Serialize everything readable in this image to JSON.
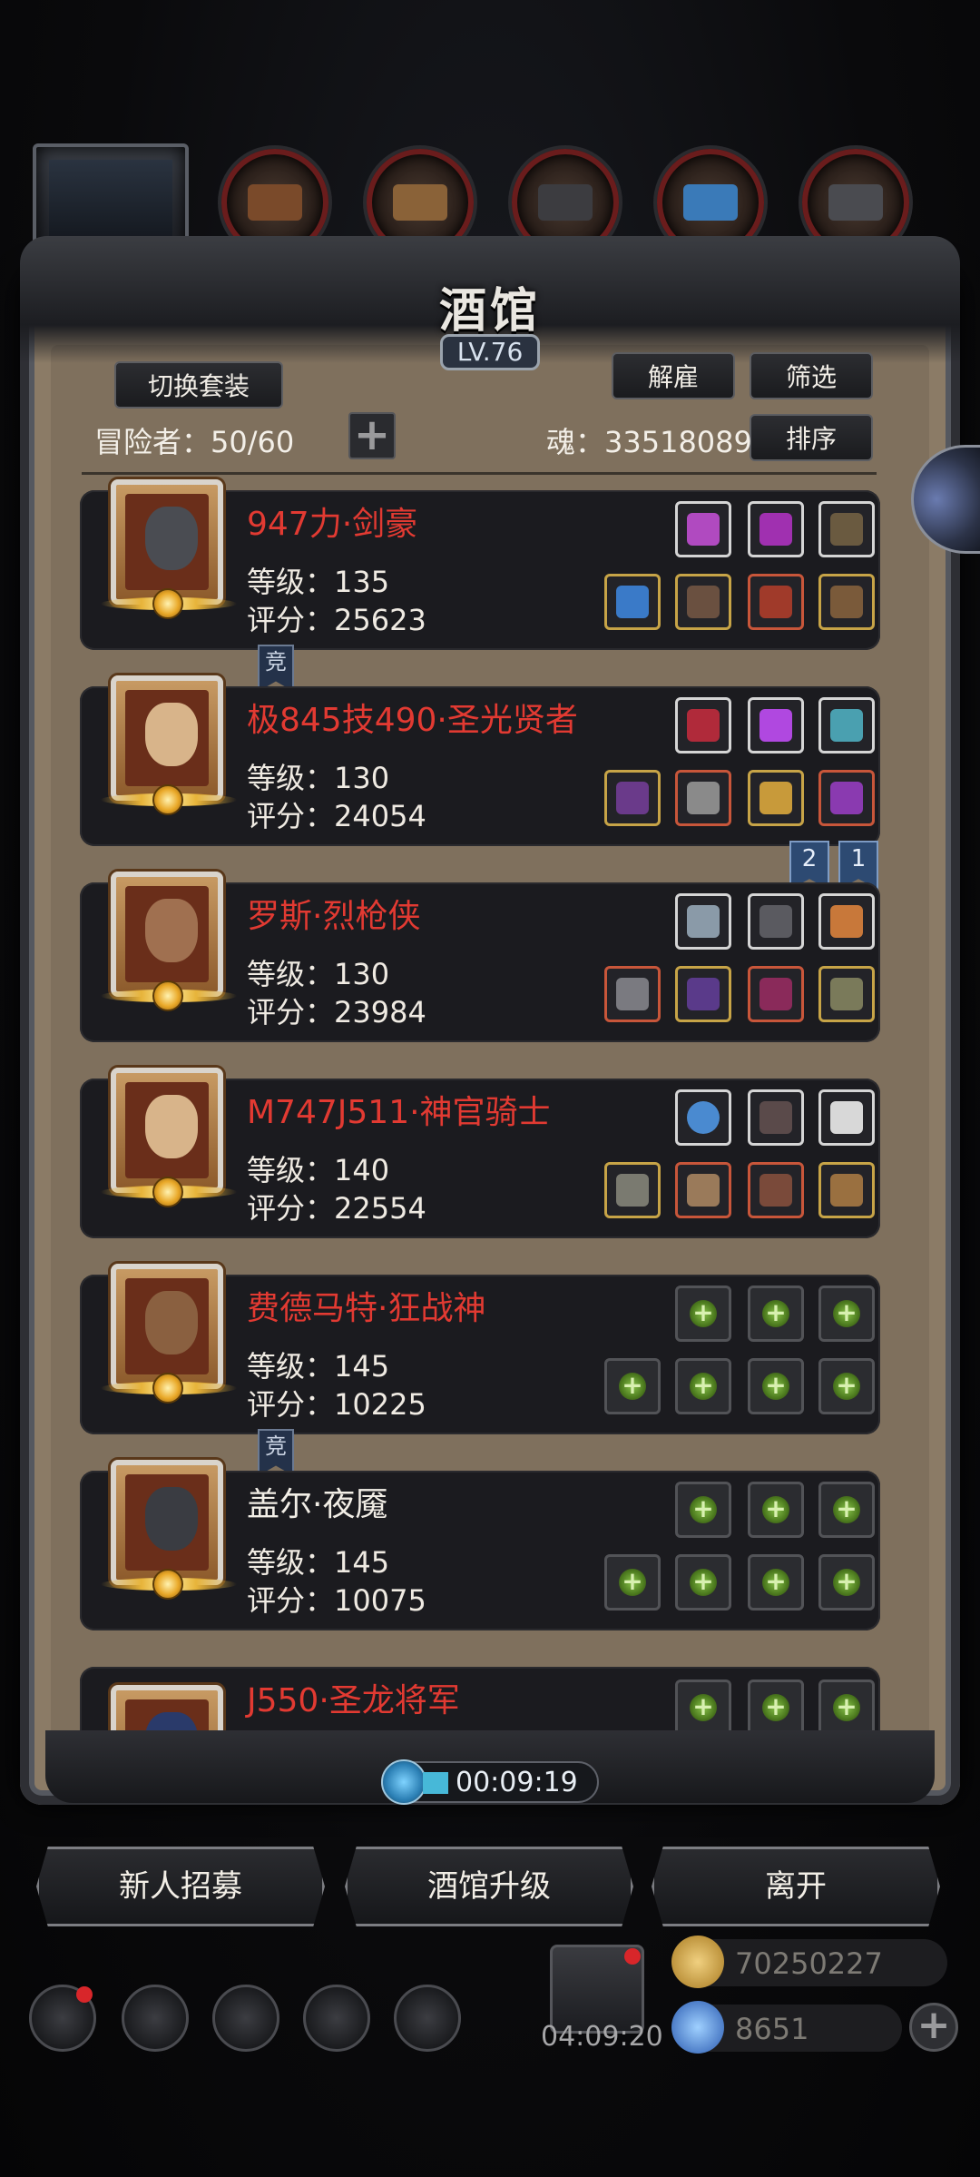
{
  "header": {
    "title": "酒馆",
    "level": "LV.76"
  },
  "toolbar": {
    "switch_outfit": "切换套装",
    "dismiss": "解雇",
    "filter": "筛选",
    "sort": "排序",
    "adventurers_label": "冒险者：50/60",
    "soul_label": "魂：33518089"
  },
  "heroes": [
    {
      "name": "947力·剑豪",
      "level": "等级：135",
      "score": "评分：25623",
      "name_color": "red"
    },
    {
      "name": "极845技490·圣光贤者",
      "level": "等级：130",
      "score": "评分：24054",
      "name_color": "red"
    },
    {
      "name": "罗斯·烈枪侠",
      "level": "等级：130",
      "score": "评分：23984",
      "name_color": "red"
    },
    {
      "name": "M747J511·神官骑士",
      "level": "等级：140",
      "score": "评分：22554",
      "name_color": "red"
    },
    {
      "name": "费德马特·狂战神",
      "level": "等级：145",
      "score": "评分：10225",
      "name_color": "red"
    },
    {
      "name": "盖尔·夜魇",
      "level": "等级：145",
      "score": "评分：10075",
      "name_color": "white"
    },
    {
      "name": "J550·圣龙将军",
      "name_color": "red"
    }
  ],
  "tags": {
    "jing": "竞",
    "num2": "2",
    "num1": "1"
  },
  "timer": "00:09:19",
  "actions": {
    "recruit": "新人招募",
    "upgrade": "酒馆升级",
    "leave": "离开"
  },
  "bottom": {
    "gift_timer": "04:09:20",
    "gold": "70250227",
    "gems": "8651"
  },
  "colors": {
    "name_red": "#e23a32",
    "panel": "#8b7b66",
    "card": "#1b1b1f"
  }
}
